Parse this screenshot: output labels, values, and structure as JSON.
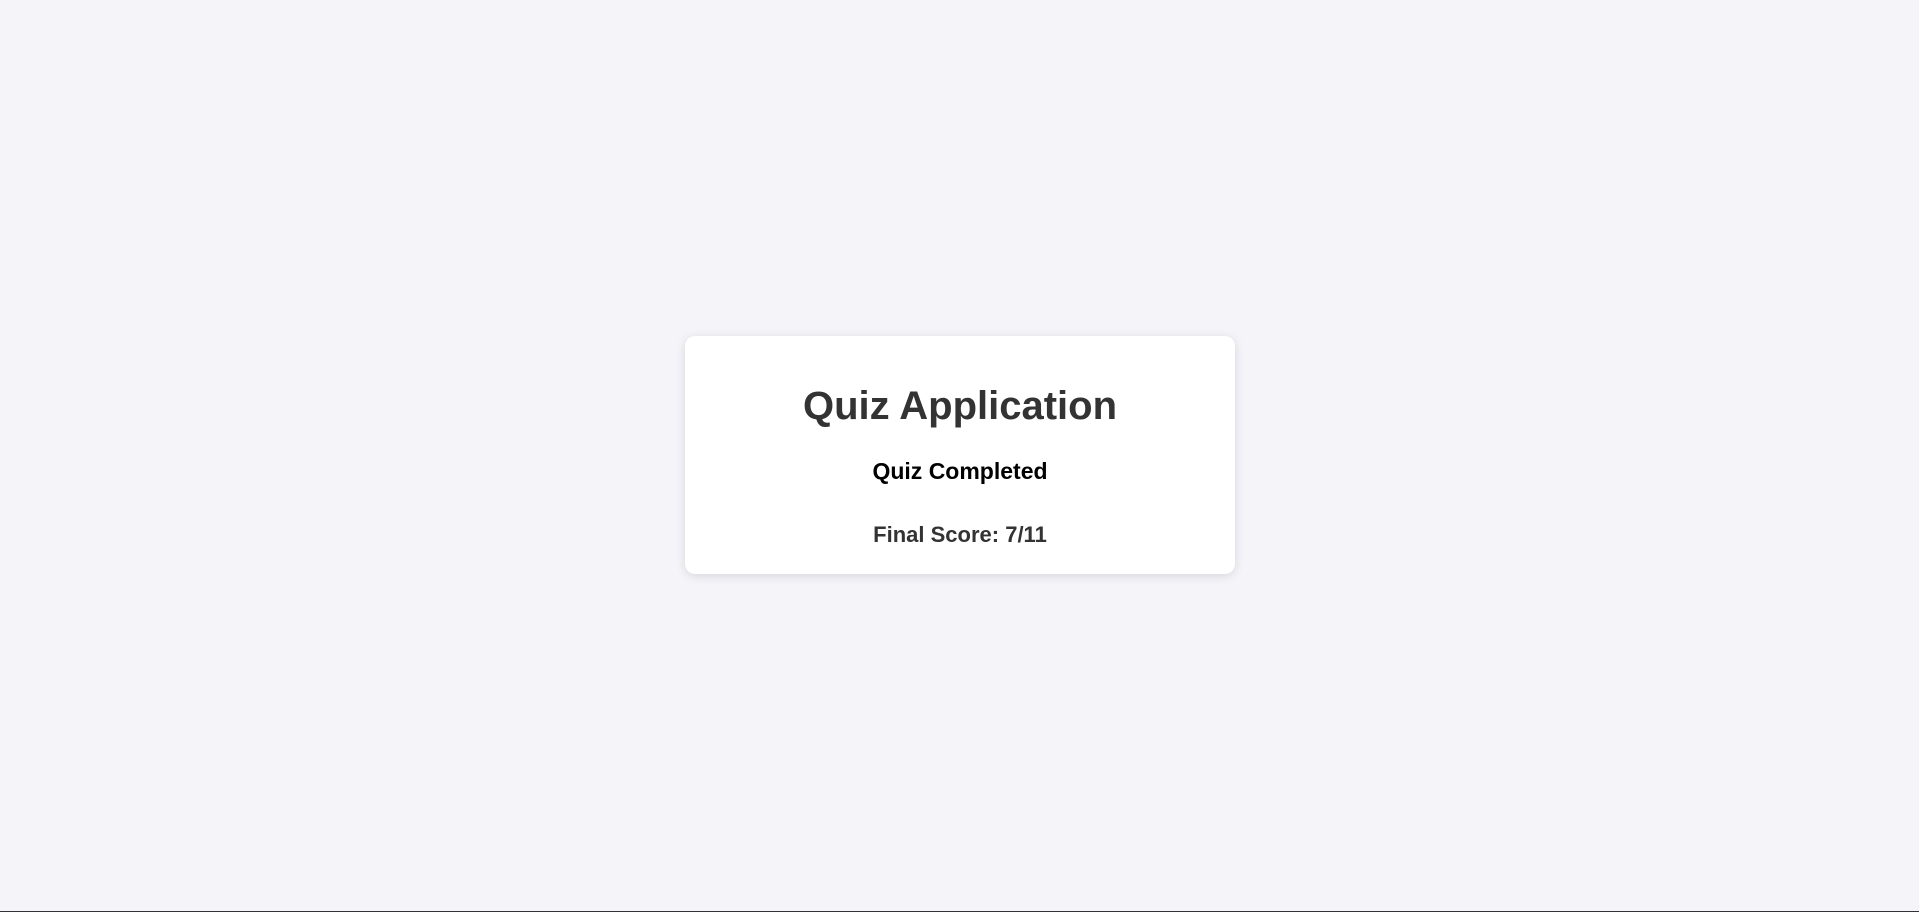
{
  "app": {
    "title": "Quiz Application"
  },
  "result": {
    "status": "Quiz Completed",
    "score_text": "Final Score: 7/11",
    "score": 7,
    "total": 11
  },
  "colors": {
    "background": "#f4f4f9",
    "card": "#ffffff",
    "title_text": "#333333",
    "status_text": "#000000"
  }
}
